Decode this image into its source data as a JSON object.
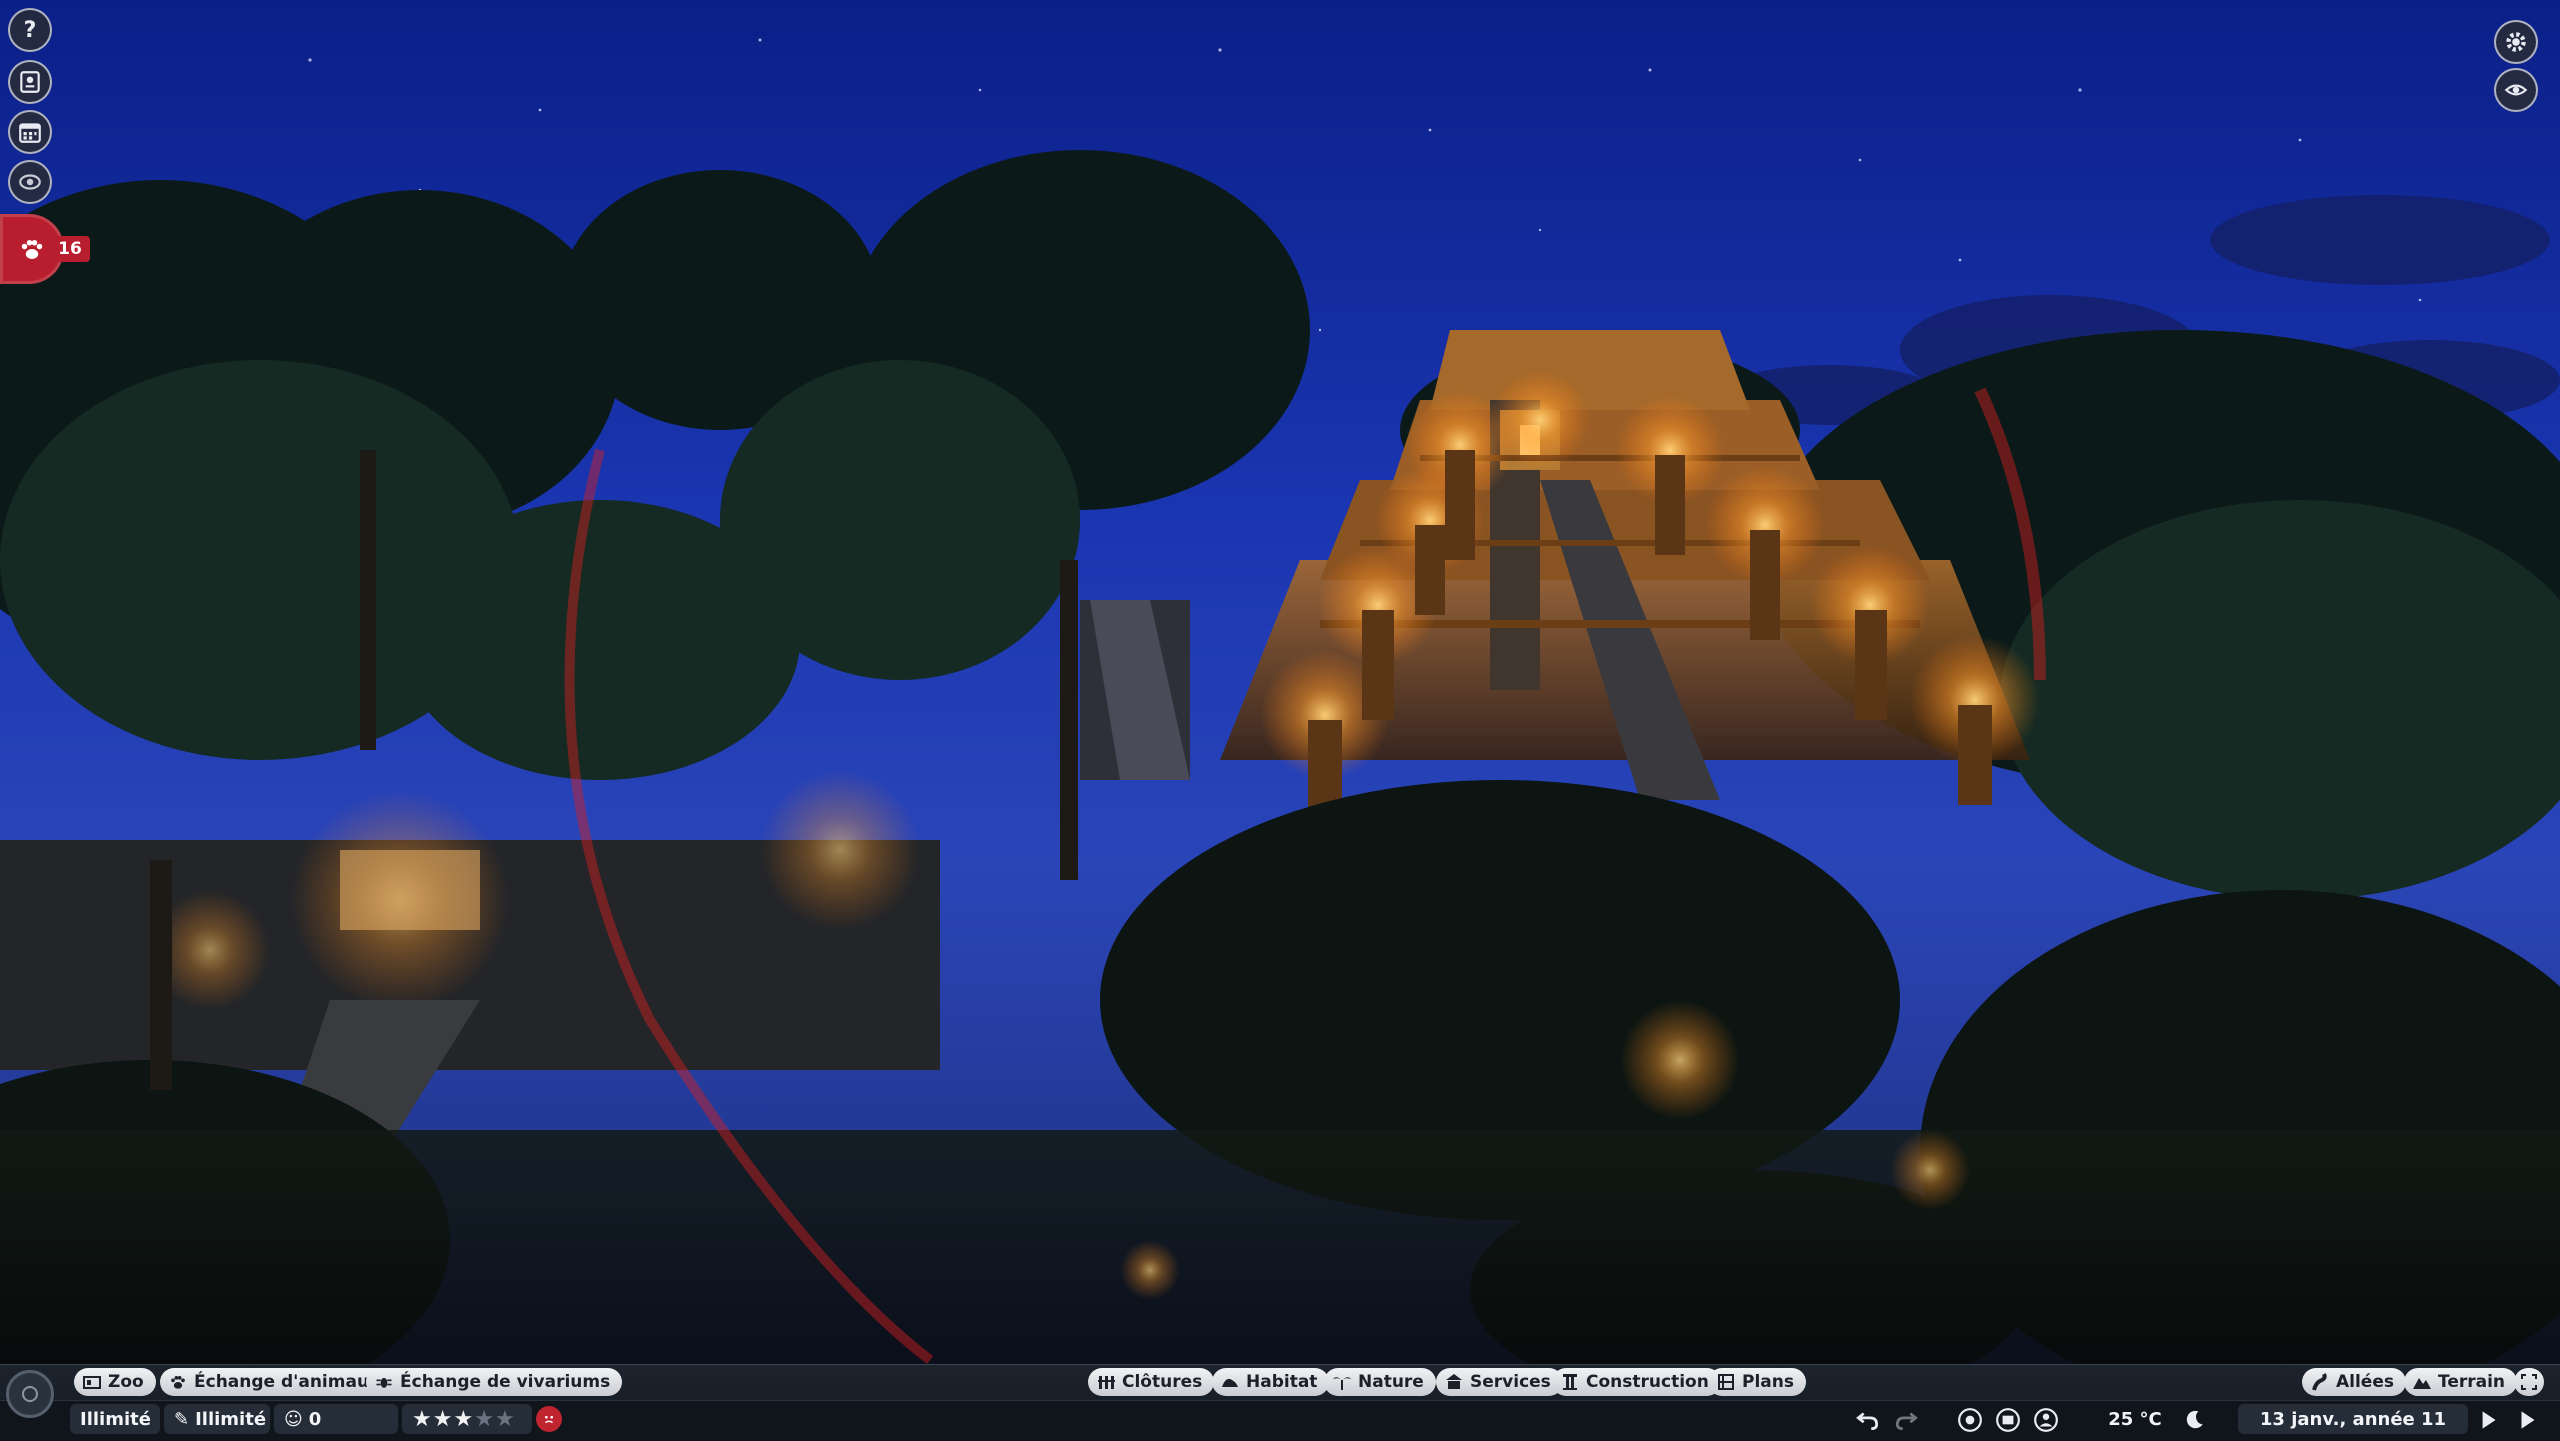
{
  "top_left_menu": [
    {
      "name": "help-icon",
      "label": "?"
    },
    {
      "name": "encyclopedia-icon"
    },
    {
      "name": "calendar-icon"
    },
    {
      "name": "view-icon"
    }
  ],
  "animals": {
    "icon": "paw-icon",
    "count": "16",
    "color": "#b81e2d"
  },
  "top_right_menu": [
    {
      "name": "settings-gear-icon"
    },
    {
      "name": "eye-icon"
    }
  ],
  "toolbar": {
    "left_tabs": [
      "Zoo",
      "Échange d'animaux",
      "Échange de vivariums"
    ],
    "center_tabs": [
      "Clôtures",
      "Habitat",
      "Nature",
      "Services",
      "Construction",
      "Plans"
    ],
    "right_tabs": [
      "Allées",
      "Terrain"
    ]
  },
  "status": {
    "money": "Illimité",
    "research": "Illimité",
    "guests": "0",
    "rating_stars": 3,
    "rating_max": 5,
    "temperature": "25 °C",
    "date": "13 janv., année 11"
  },
  "colors": {
    "tab_bg": "#e2e4e8",
    "bar_bg": "#1a2029",
    "accent_red": "#b81e2d",
    "star": "#f2f2f2"
  }
}
